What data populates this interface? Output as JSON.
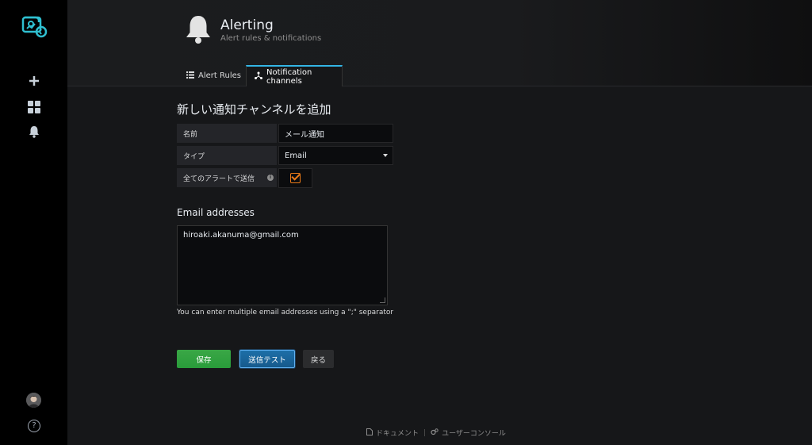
{
  "header": {
    "title": "Alerting",
    "subtitle": "Alert rules & notifications"
  },
  "tabs": [
    {
      "label": "Alert Rules",
      "icon": "list-icon"
    },
    {
      "label": "Notification channels",
      "icon": "share-icon",
      "active": true
    }
  ],
  "form": {
    "title": "新しい通知チャンネルを追加",
    "name_label": "名前",
    "name_value": "メール通知",
    "type_label": "タイプ",
    "type_value": "Email",
    "send_all_label": "全てのアラートで送信",
    "send_all_checked": true
  },
  "email": {
    "title": "Email addresses",
    "value": "hiroaki.akanuma@gmail.com",
    "hint": "You can enter multiple email addresses using a \";\" separator"
  },
  "buttons": {
    "save": "保存",
    "test": "送信テスト",
    "back": "戻る"
  },
  "footer": {
    "docs": "ドキュメント",
    "separator": "|",
    "console": "ユーザーコンソール"
  },
  "colors": {
    "accent": "#33b5e5",
    "checkbox": "#eb7b18",
    "save": "#299c3a",
    "test": "#1d6fa8"
  }
}
